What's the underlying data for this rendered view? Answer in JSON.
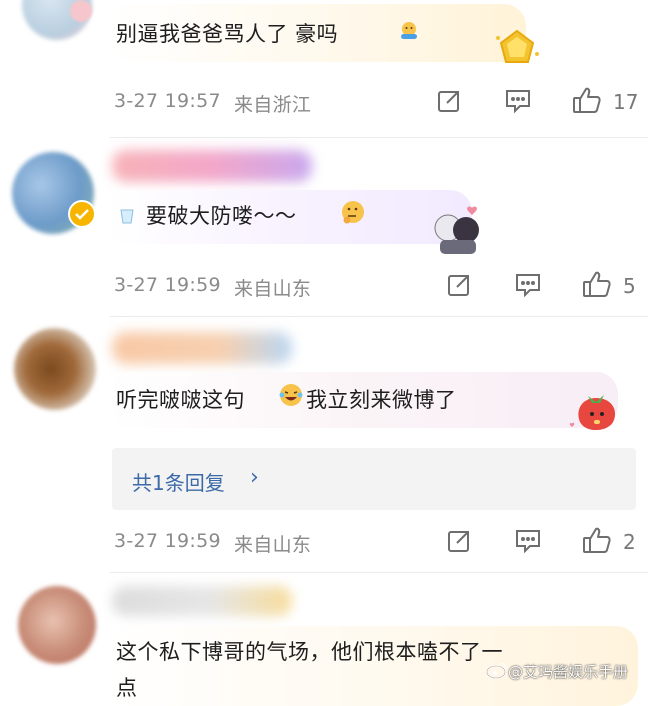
{
  "comments": [
    {
      "text": "别逼我爸爸骂人了 豪吗",
      "time": "3-27 19:57",
      "location": "来自浙江",
      "likes": "17"
    },
    {
      "text": "要破大防喽～～",
      "time": "3-27 19:59",
      "location": "来自山东",
      "likes": "5"
    },
    {
      "text": "听完啵啵这句",
      "text_after_emoji": "我立刻来微博了",
      "time": "3-27 19:59",
      "location": "来自山东",
      "likes": "2",
      "replies_label": "共1条回复",
      "replies_chevron": "›"
    },
    {
      "text_line1": "这个私下博哥的气场，他们根本嗑不了一",
      "text_line2": "点"
    }
  ],
  "watermark": "@艾玛酱娱乐手册",
  "colors": {
    "reply_link": "#3c6aa8",
    "meta_text": "#8a8a8a",
    "icon": "#6e6e6e"
  },
  "icons": [
    "share-icon",
    "comment-icon",
    "like-icon",
    "weibo-logo-icon"
  ]
}
